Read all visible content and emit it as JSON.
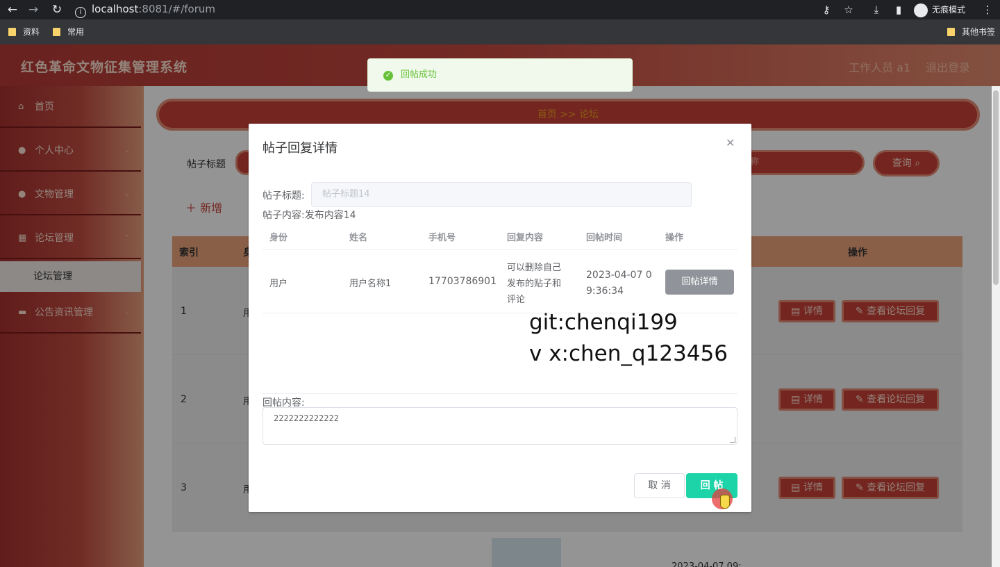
{
  "browser": {
    "url_host": "localhost",
    "url_rest": ":8081/#/forum",
    "incognito_label": "无痕模式",
    "bookmarks": [
      "资料",
      "常用"
    ],
    "other_bookmarks": "其他书签"
  },
  "app": {
    "title": "红色革命文物征集管理系统",
    "user_label": "工作人员 a1",
    "logout_label": "退出登录"
  },
  "sidebar": {
    "items": [
      {
        "label": "首页",
        "icon": "home-icon"
      },
      {
        "label": "个人中心",
        "icon": "user-icon"
      },
      {
        "label": "文物管理",
        "icon": "user-icon"
      },
      {
        "label": "论坛管理",
        "icon": "grid-icon"
      },
      {
        "label": "公告资讯管理",
        "icon": "briefcase-icon"
      }
    ],
    "sub_item": "论坛管理"
  },
  "main": {
    "breadcrumb": "首页 >> 论坛",
    "search_label": "帖子标题",
    "search_placeholder_2": "称",
    "search_button": "查询",
    "add_button": "新增",
    "table_headers": [
      "索引",
      "身",
      "操作"
    ],
    "rows": [
      {
        "index": "1",
        "col2": "用"
      },
      {
        "index": "2",
        "col2": "用"
      },
      {
        "index": "3",
        "col2": "用"
      }
    ],
    "detail_button": "详情",
    "view_reply_button": "查看论坛回复",
    "partial_time": "2023-04-07 09:"
  },
  "toast": {
    "message": "回帖成功",
    "color": "#67c23a"
  },
  "dialog": {
    "title": "帖子回复详情",
    "title_label": "帖子标题:",
    "title_value": "帖子标题14",
    "content_label": "帖子内容:",
    "content_value": "发布内容14",
    "columns": [
      "身份",
      "姓名",
      "手机号",
      "回复内容",
      "回帖时间",
      "操作"
    ],
    "replies": [
      {
        "role": "用户",
        "name": "用户名称1",
        "phone": "17703786901",
        "content_lines": [
          "可以删除自己",
          "发布的贴子和",
          "评论"
        ],
        "time_lines": [
          "2023-04-07 0",
          "9:36:34"
        ],
        "action": "回帖详情"
      }
    ],
    "watermark_lines": [
      "git:chenqi199",
      "v x:chen_q123456"
    ],
    "reply_label": "回帖内容:",
    "reply_value": "2222222222222",
    "cancel_button": "取 消",
    "submit_button": "回 帖",
    "submit_color": "#1dd4a8"
  }
}
